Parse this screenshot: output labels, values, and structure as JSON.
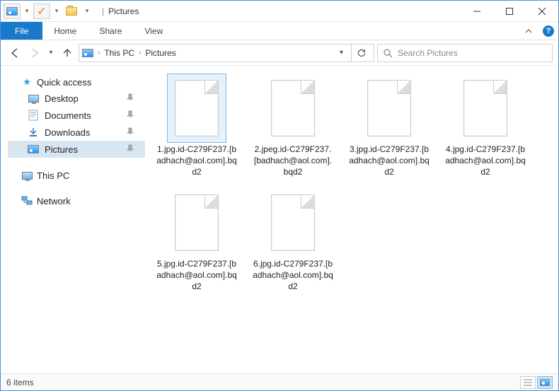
{
  "window": {
    "title": "Pictures"
  },
  "ribbon": {
    "file": "File",
    "tabs": [
      "Home",
      "Share",
      "View"
    ]
  },
  "breadcrumb": {
    "root": "This PC",
    "folder": "Pictures"
  },
  "search": {
    "placeholder": "Search Pictures"
  },
  "sidebar": {
    "quick_access": "Quick access",
    "items": [
      {
        "label": "Desktop",
        "pinned": true
      },
      {
        "label": "Documents",
        "pinned": true
      },
      {
        "label": "Downloads",
        "pinned": true
      },
      {
        "label": "Pictures",
        "pinned": true,
        "selected": true
      }
    ],
    "this_pc": "This PC",
    "network": "Network"
  },
  "files": [
    {
      "name": "1.jpg.id-C279F237.[badhach@aol.com].bqd2",
      "selected": true
    },
    {
      "name": "2.jpeg.id-C279F237.[badhach@aol.com].bqd2"
    },
    {
      "name": "3.jpg.id-C279F237.[badhach@aol.com].bqd2"
    },
    {
      "name": "4.jpg.id-C279F237.[badhach@aol.com].bqd2"
    },
    {
      "name": "5.jpg.id-C279F237.[badhach@aol.com].bqd2"
    },
    {
      "name": "6.jpg.id-C279F237.[badhach@aol.com].bqd2"
    }
  ],
  "status": {
    "count": "6 items"
  }
}
